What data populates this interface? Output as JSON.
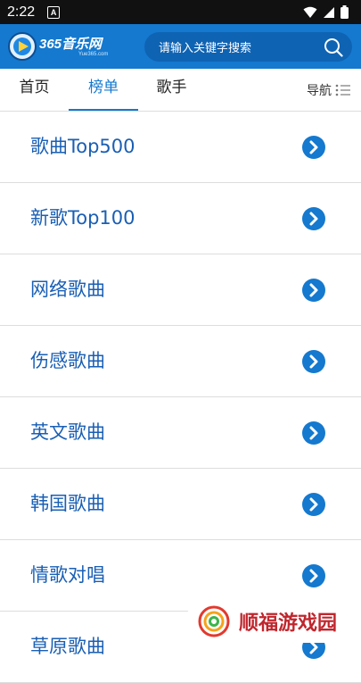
{
  "status_bar": {
    "time": "2:22",
    "notification_glyph": "A"
  },
  "header": {
    "logo_text": "365音乐网",
    "logo_sub": "Yue365.com",
    "search": {
      "placeholder": "请输入关键字搜索"
    }
  },
  "tabs": {
    "items": [
      {
        "label": "首页",
        "active": false
      },
      {
        "label": "榜单",
        "active": true
      },
      {
        "label": "歌手",
        "active": false
      }
    ],
    "nav_label": "导航"
  },
  "charts": [
    {
      "label": "歌曲Top500"
    },
    {
      "label": "新歌Top100"
    },
    {
      "label": "网络歌曲"
    },
    {
      "label": "伤感歌曲"
    },
    {
      "label": "英文歌曲"
    },
    {
      "label": "韩国歌曲"
    },
    {
      "label": "情歌对唱"
    },
    {
      "label": "草原歌曲"
    }
  ],
  "watermark": {
    "text": "顺福游戏园"
  },
  "colors": {
    "accent": "#1479cf",
    "link": "#1a5fb4",
    "watermark": "#c0262d"
  }
}
